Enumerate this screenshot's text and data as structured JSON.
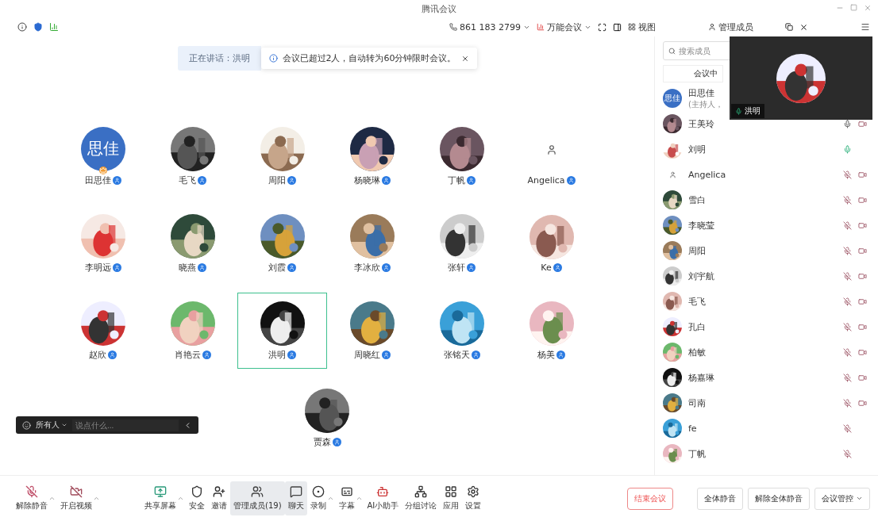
{
  "window": {
    "title": "腾讯会议"
  },
  "top_bar": {
    "meeting_items": [
      {
        "label": "861 183 2799",
        "dropdown": true
      },
      {
        "label": "万能会议",
        "dropdown": true
      }
    ],
    "view_label": "视图",
    "members_label": "管理成员"
  },
  "speaking": {
    "label": "正在讲话：洪明"
  },
  "notice": {
    "text": "会议已超过2人，自动转为60分钟限时会议。"
  },
  "participants": [
    {
      "name": "田思佳",
      "kind": "text",
      "initials": "思佳",
      "host": true,
      "selected": false
    },
    {
      "name": "毛飞",
      "kind": "picture",
      "host": false,
      "selected": false
    },
    {
      "name": "周阳",
      "kind": "picture",
      "host": false,
      "selected": false
    },
    {
      "name": "杨晓琳",
      "kind": "picture",
      "host": false,
      "selected": false
    },
    {
      "name": "丁帆",
      "kind": "picture",
      "host": false,
      "selected": false
    },
    {
      "name": "Angelica",
      "kind": "icon",
      "host": false,
      "selected": false
    },
    {
      "name": "李明远",
      "kind": "picture",
      "host": false,
      "selected": false
    },
    {
      "name": "晓燕",
      "kind": "picture",
      "host": false,
      "selected": false
    },
    {
      "name": "刘霞",
      "kind": "picture",
      "host": false,
      "selected": false
    },
    {
      "name": "李冰欣",
      "kind": "picture",
      "host": false,
      "selected": false
    },
    {
      "name": "张轩",
      "kind": "picture",
      "host": false,
      "selected": false
    },
    {
      "name": "Ke",
      "kind": "picture",
      "host": false,
      "selected": false
    },
    {
      "name": "赵欣",
      "kind": "picture",
      "host": false,
      "selected": false
    },
    {
      "name": "肖艳云",
      "kind": "picture",
      "host": false,
      "selected": false
    },
    {
      "name": "洪明",
      "kind": "picture",
      "host": false,
      "selected": true
    },
    {
      "name": "周晓红",
      "kind": "picture",
      "host": false,
      "selected": false
    },
    {
      "name": "张铭天",
      "kind": "picture",
      "host": false,
      "selected": false
    },
    {
      "name": "杨美",
      "kind": "picture",
      "host": false,
      "selected": false
    },
    {
      "name": "贾森",
      "kind": "picture",
      "host": false,
      "selected": false
    }
  ],
  "chat_bar": {
    "recipient": "所有人",
    "placeholder": "说点什么..."
  },
  "side_panel": {
    "search_placeholder": "搜索成员",
    "tab": "会议中",
    "members": [
      {
        "name": "田思佳",
        "subtitle": "(主持人，",
        "kind": "text",
        "initials": "思佳"
      },
      {
        "name": "王美玲",
        "kind": "picture",
        "muted": false,
        "speaking": false,
        "camera": true
      },
      {
        "name": "刘明",
        "kind": "picture",
        "muted": false,
        "speaking": true,
        "camera": false
      },
      {
        "name": "Angelica",
        "kind": "icon",
        "muted": true,
        "camera": true
      },
      {
        "name": "雪白",
        "kind": "picture",
        "muted": true,
        "camera": true
      },
      {
        "name": "李晓莹",
        "kind": "picture",
        "muted": true,
        "camera": true
      },
      {
        "name": "周阳",
        "kind": "picture",
        "muted": true,
        "camera": true
      },
      {
        "name": "刘宇航",
        "kind": "picture",
        "muted": true,
        "camera": true
      },
      {
        "name": "毛飞",
        "kind": "picture",
        "muted": true,
        "camera": true
      },
      {
        "name": "孔白",
        "kind": "picture",
        "muted": true,
        "camera": true
      },
      {
        "name": "柏敏",
        "kind": "picture",
        "muted": true,
        "camera": true
      },
      {
        "name": "杨嘉琳",
        "kind": "picture",
        "muted": true,
        "camera": true
      },
      {
        "name": "司南",
        "kind": "picture",
        "muted": true,
        "camera": true
      },
      {
        "name": "fe",
        "kind": "picture",
        "muted": true,
        "camera": false
      },
      {
        "name": "丁帆",
        "kind": "picture",
        "muted": true,
        "camera": false
      }
    ],
    "video_overlay": {
      "name": "洪明"
    },
    "actions": [
      {
        "label": "全体静音",
        "dropdown": false
      },
      {
        "label": "解除全体静音",
        "dropdown": false
      },
      {
        "label": "会议管控",
        "dropdown": true
      }
    ]
  },
  "toolbar": {
    "items": [
      {
        "label": "解除静音",
        "menu": true,
        "selected": false
      },
      {
        "label": "开启视频",
        "menu": true,
        "selected": false
      },
      {
        "label": "共享屏幕",
        "menu": true,
        "selected": false
      },
      {
        "label": "安全",
        "menu": false,
        "selected": false
      },
      {
        "label": "邀请",
        "menu": false,
        "selected": false
      },
      {
        "label": "管理成员(19)",
        "menu": false,
        "selected": true
      },
      {
        "label": "聊天",
        "menu": false,
        "selected": true
      },
      {
        "label": "录制",
        "menu": true,
        "selected": false
      },
      {
        "label": "字幕",
        "menu": true,
        "selected": false
      },
      {
        "label": "AI小助手",
        "menu": false,
        "selected": false
      },
      {
        "label": "分组讨论",
        "menu": false,
        "selected": false
      },
      {
        "label": "应用",
        "menu": false,
        "selected": false
      },
      {
        "label": "设置",
        "menu": false,
        "selected": false
      }
    ],
    "end_button": "结束会议"
  }
}
